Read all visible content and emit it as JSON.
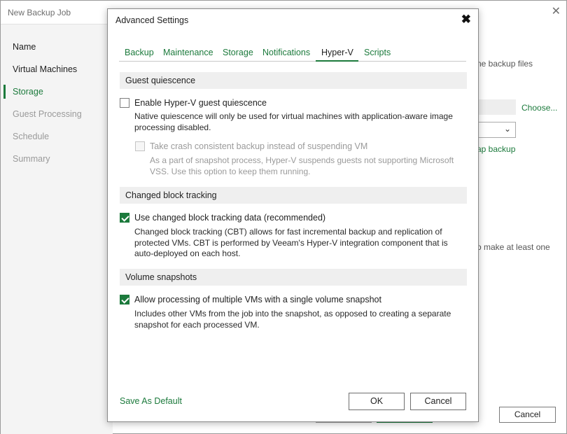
{
  "parent": {
    "title": "New Backup Job",
    "close_glyph": "✕",
    "nav": [
      "Name",
      "Virtual Machines",
      "Storage",
      "Guest Processing",
      "Schedule",
      "Summary"
    ],
    "bg_text_files": "ne backup files",
    "bg_choose": "Choose...",
    "bg_dropdown_chevron": "⌄",
    "bg_snap": "ap backup",
    "bg_make": "o make at least one",
    "bg_cancel": "Cancel"
  },
  "dialog": {
    "title": "Advanced Settings",
    "close_glyph": "✖",
    "tabs": [
      "Backup",
      "Maintenance",
      "Storage",
      "Notifications",
      "Hyper-V",
      "Scripts"
    ],
    "active_tab": "Hyper-V",
    "sections": {
      "guest": {
        "header": "Guest quiescence",
        "opt1_label": "Enable Hyper-V guest quiescence",
        "opt1_desc": "Native quiescence will only be used for virtual machines with application-aware image processing disabled.",
        "opt2_label": "Take crash consistent backup instead of suspending VM",
        "opt2_desc": "As a part of snapshot process, Hyper-V suspends guests not supporting Microsoft VSS. Use this option to keep them running."
      },
      "cbt": {
        "header": "Changed block tracking",
        "opt_label": "Use changed block tracking data (recommended)",
        "opt_desc": "Changed block tracking (CBT) allows for fast incremental backup and replication of protected VMs. CBT is performed by Veeam's Hyper-V integration component that is auto-deployed on each host."
      },
      "volume": {
        "header": "Volume snapshots",
        "opt_label": "Allow processing of multiple VMs with a single volume snapshot",
        "opt_desc": "Includes other VMs from the job into the snapshot, as opposed to creating a separate snapshot for each processed VM."
      }
    },
    "save_default": "Save As Default",
    "ok": "OK",
    "cancel": "Cancel"
  },
  "colors": {
    "accent": "#1c7a3c",
    "section_bg": "#efefef",
    "disabled_text": "#9a9a9a"
  },
  "icons": {
    "parent_close": "close-icon",
    "dialog_close": "close-icon",
    "dropdown": "chevron-down-icon",
    "checkbox_checked": "checkmark-icon"
  }
}
